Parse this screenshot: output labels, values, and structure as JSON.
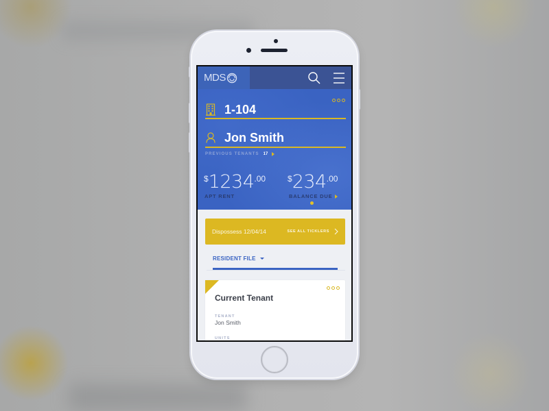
{
  "header": {
    "logo_text": "MDS",
    "search_icon": "search-icon",
    "menu_icon": "hamburger-menu-icon"
  },
  "property": {
    "unit": "1-104",
    "tenant_name": "Jon Smith",
    "previous_tenants_label": "PREVIOUS TENANTS",
    "previous_tenants_count": "17"
  },
  "amounts": {
    "rent": {
      "currency": "$",
      "whole": "1234",
      "cents": ".00",
      "label": "APT RENT"
    },
    "balance": {
      "currency": "$",
      "whole": "234",
      "cents": ".00",
      "label": "BALANCE DUE"
    }
  },
  "pager": {
    "current_page": 1,
    "total_pages": 1
  },
  "tickler": {
    "text": "Dispossess 12/04/14",
    "link_label": "SEE ALL TICKLERS"
  },
  "tab": {
    "label": "RESIDENT FILE"
  },
  "card": {
    "title": "Current Tenant",
    "fields": [
      {
        "label": "TENANT",
        "value": "Jon Smith"
      },
      {
        "label": "UNITS",
        "value": ""
      }
    ]
  },
  "colors": {
    "brand_blue": "#3a63c2",
    "topbar_blue": "#3b5394",
    "accent_yellow": "#dcb822"
  }
}
